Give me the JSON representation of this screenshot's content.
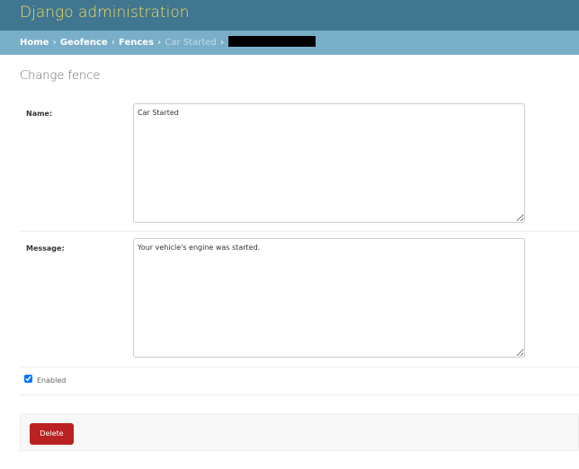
{
  "header": {
    "site_title": "Django administration"
  },
  "breadcrumbs": {
    "items": [
      "Home",
      "Geofence",
      "Fences"
    ],
    "separator": "›",
    "current": "Car Started"
  },
  "page": {
    "title": "Change fence"
  },
  "form": {
    "name": {
      "label": "Name:",
      "value": "Car Started"
    },
    "message": {
      "label": "Message:",
      "value": "Your vehicle's engine was started."
    },
    "enabled": {
      "label": "Enabled",
      "checked": true
    }
  },
  "actions": {
    "delete_label": "Delete"
  },
  "colors": {
    "header_bg": "#417690",
    "site_title": "#f5dd5d",
    "breadcrumbs_bg": "#79aec8",
    "delete_bg": "#ba2121"
  }
}
